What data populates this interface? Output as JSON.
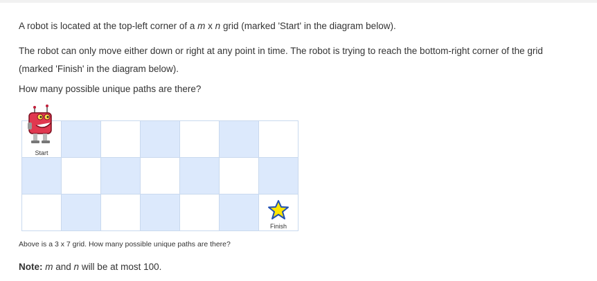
{
  "paragraphs": {
    "p1_before": "A robot is located at the top-left corner of a ",
    "p1_m": "m",
    "p1_x": " x ",
    "p1_n": "n",
    "p1_after": " grid (marked 'Start' in the diagram below).",
    "p2": "The robot can only move either down or right at any point in time. The robot is trying to reach the bottom-right corner of the grid (marked 'Finish' in the diagram below).",
    "p3": "How many possible unique paths are there?"
  },
  "grid": {
    "rows": 3,
    "cols": 7,
    "start_label": "Start",
    "finish_label": "Finish",
    "colors": {
      "blue": "#dce9fc",
      "white": "#ffffff",
      "border": "#c9d9ee"
    }
  },
  "caption": "Above is a 3 x 7 grid. How many possible unique paths are there?",
  "note": {
    "label": "Note:",
    "m": "m",
    "and": " and ",
    "n": "n",
    "rest": " will be at most 100."
  },
  "icons": {
    "start": "robot-icon",
    "finish": "star-icon"
  }
}
